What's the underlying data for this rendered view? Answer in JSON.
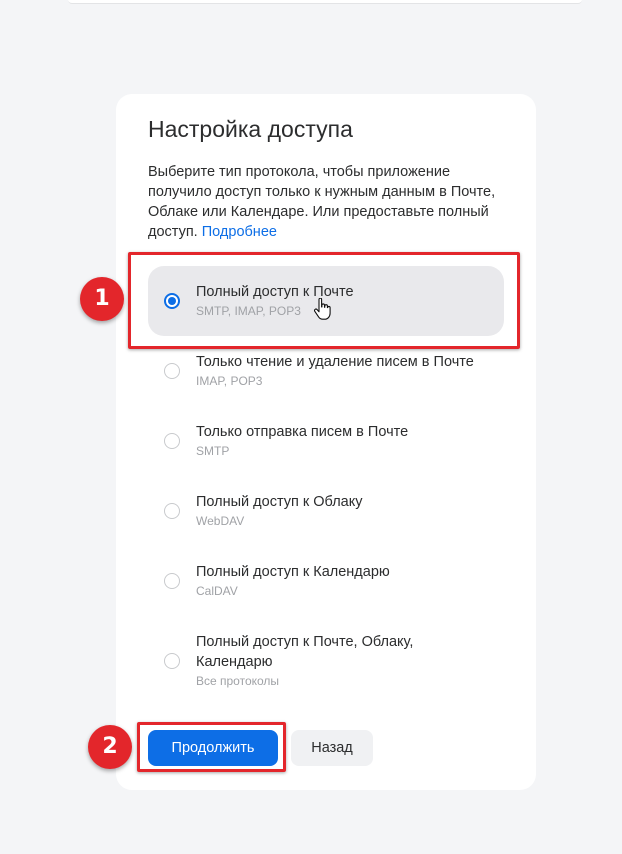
{
  "dialog": {
    "title": "Настройка доступа",
    "description": "Выберите тип протокола, чтобы приложение получило доступ только к нужным данным в Почте, Облаке или Календаре. Или предоставьте полный доступ.",
    "more_link": "Подробнее"
  },
  "options": [
    {
      "label": "Полный доступ к Почте",
      "sub": "SMTP, IMAP, POP3",
      "selected": true
    },
    {
      "label": "Только чтение и удаление писем в Почте",
      "sub": "IMAP, POP3",
      "selected": false
    },
    {
      "label": "Только отправка писем в Почте",
      "sub": "SMTP",
      "selected": false
    },
    {
      "label": "Полный доступ к Облаку",
      "sub": "WebDAV",
      "selected": false
    },
    {
      "label": "Полный доступ к Календарю",
      "sub": "CalDAV",
      "selected": false
    },
    {
      "label": "Полный доступ к Почте, Облаку, Календарю",
      "sub": "Все протоколы",
      "selected": false
    }
  ],
  "buttons": {
    "continue": "Продолжить",
    "back": "Назад"
  },
  "annotations": {
    "step1": "1",
    "step2": "2"
  },
  "colors": {
    "accent": "#0d6ee6",
    "annotation": "#e3262b",
    "selected_bg": "#e9e9ec"
  }
}
